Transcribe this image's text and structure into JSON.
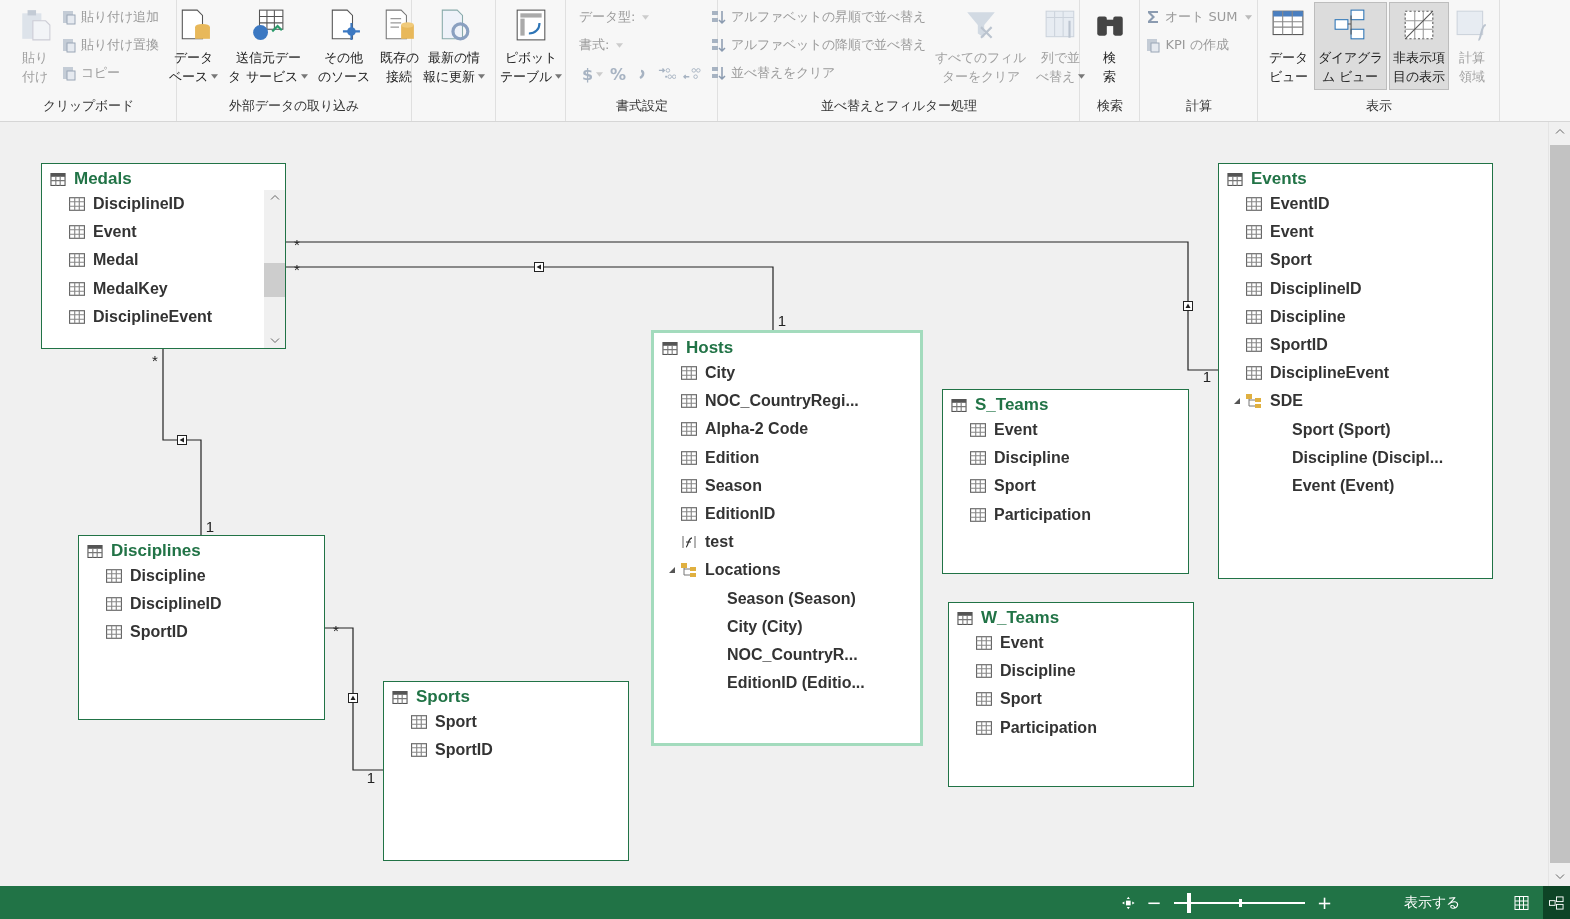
{
  "ribbon": {
    "groups": [
      {
        "label": "クリップボード",
        "items": [
          {
            "kind": "large",
            "lines": [
              "貼り",
              "付け"
            ],
            "disabled": true,
            "dropdown": false,
            "selected": false
          },
          {
            "kind": "stack",
            "items": [
              {
                "kind": "small",
                "label": "貼り付け追加",
                "disabled": true,
                "dropdown": false
              },
              {
                "kind": "small",
                "label": "貼り付け置換",
                "disabled": true,
                "dropdown": false
              },
              {
                "kind": "small",
                "label": "コピー",
                "disabled": true,
                "dropdown": false
              }
            ]
          }
        ]
      },
      {
        "label": "外部データの取り込み",
        "items": [
          {
            "kind": "large",
            "lines": [
              "データ",
              "ベース"
            ],
            "disabled": false,
            "dropdown": true,
            "selected": false
          },
          {
            "kind": "large",
            "lines": [
              "送信元デー",
              "タ サービス"
            ],
            "disabled": false,
            "dropdown": true,
            "selected": false
          },
          {
            "kind": "large",
            "lines": [
              "その他",
              "のソース"
            ],
            "disabled": false,
            "dropdown": false,
            "selected": false
          },
          {
            "kind": "large",
            "lines": [
              "既存の",
              "接続"
            ],
            "disabled": false,
            "dropdown": false,
            "selected": false
          }
        ]
      },
      {
        "items": [
          {
            "kind": "large",
            "lines": [
              "最新の情",
              "報に更新"
            ],
            "disabled": false,
            "dropdown": true,
            "selected": false
          }
        ]
      },
      {
        "items": [
          {
            "kind": "large",
            "lines": [
              "ピボット",
              "テーブル"
            ],
            "disabled": false,
            "dropdown": true,
            "selected": false
          }
        ]
      },
      {
        "label": "書式設定",
        "items": [
          {
            "kind": "stack",
            "items": [
              {
                "kind": "field-label",
                "label": "データ型:",
                "disabled": true,
                "dropdown": true
              },
              {
                "kind": "field-label",
                "label": "書式:",
                "disabled": true,
                "dropdown": true
              },
              {
                "kind": "symbol-row",
                "disabled": true,
                "symbols": [
                  {
                    "kind": "text",
                    "label": "$",
                    "dropdown": true
                  },
                  {
                    "kind": "text",
                    "label": "%",
                    "dropdown": false
                  },
                  {
                    "kind": "comma"
                  },
                  {
                    "kind": "inc-decimal"
                  },
                  {
                    "kind": "dec-decimal"
                  }
                ]
              }
            ]
          }
        ]
      },
      {
        "label": "並べ替えとフィルター処理",
        "items": [
          {
            "kind": "stack",
            "items": [
              {
                "kind": "small",
                "label": "アルファベットの昇順で並べ替え",
                "disabled": true,
                "dropdown": false
              },
              {
                "kind": "small",
                "label": "アルファベットの降順で並べ替え",
                "disabled": true,
                "dropdown": false
              },
              {
                "kind": "small",
                "label": "並べ替えをクリア",
                "disabled": true,
                "dropdown": false
              }
            ]
          },
          {
            "kind": "large",
            "lines": [
              "すべてのフィル",
              "ターをクリア"
            ],
            "disabled": true,
            "dropdown": false,
            "selected": false
          },
          {
            "kind": "large",
            "lines": [
              "列で並",
              "べ替え"
            ],
            "disabled": true,
            "dropdown": true,
            "selected": false
          }
        ]
      },
      {
        "label": "検索",
        "items": [
          {
            "kind": "large",
            "lines": [
              "検",
              "索"
            ],
            "disabled": false,
            "dropdown": false,
            "selected": false
          }
        ]
      },
      {
        "label": "計算",
        "items": [
          {
            "kind": "stack",
            "items": [
              {
                "kind": "small",
                "label": "オート SUM",
                "disabled": true,
                "dropdown": true
              },
              {
                "kind": "small",
                "label": "KPI の作成",
                "disabled": true,
                "dropdown": false
              }
            ]
          }
        ]
      },
      {
        "label": "表示",
        "items": [
          {
            "kind": "large",
            "lines": [
              "データ",
              "ビュー"
            ],
            "disabled": false,
            "dropdown": false,
            "selected": false
          },
          {
            "kind": "large",
            "lines": [
              "ダイアグラ",
              "ム ビュー"
            ],
            "disabled": false,
            "dropdown": false,
            "selected": true
          },
          {
            "kind": "large",
            "lines": [
              "非表示項",
              "目の表示"
            ],
            "disabled": false,
            "dropdown": false,
            "selected": true
          },
          {
            "kind": "large",
            "lines": [
              "計算",
              "領域"
            ],
            "disabled": true,
            "dropdown": false,
            "selected": false
          }
        ]
      }
    ]
  },
  "diagram": {
    "tables": [
      {
        "name": "Medals",
        "selected": false,
        "scrollable": true,
        "fields": [
          {
            "kind": "column",
            "name": "DisciplineID"
          },
          {
            "kind": "column",
            "name": "Event"
          },
          {
            "kind": "column",
            "name": "Medal"
          },
          {
            "kind": "column",
            "name": "MedalKey"
          },
          {
            "kind": "column",
            "name": "DisciplineEvent"
          }
        ]
      },
      {
        "name": "Events",
        "selected": false,
        "scrollable": false,
        "fields": [
          {
            "kind": "column",
            "name": "EventID"
          },
          {
            "kind": "column",
            "name": "Event"
          },
          {
            "kind": "column",
            "name": "Sport"
          },
          {
            "kind": "column",
            "name": "DisciplineID"
          },
          {
            "kind": "column",
            "name": "Discipline"
          },
          {
            "kind": "column",
            "name": "SportID"
          },
          {
            "kind": "column",
            "name": "DisciplineEvent"
          },
          {
            "kind": "hierarchy",
            "name": "SDE",
            "expanded": true,
            "children": [
              {
                "name": "Sport (Sport)"
              },
              {
                "name": "Discipline (Discipl..."
              },
              {
                "name": "Event (Event)"
              }
            ]
          }
        ]
      },
      {
        "name": "Hosts",
        "selected": true,
        "scrollable": false,
        "fields": [
          {
            "kind": "column",
            "name": "City"
          },
          {
            "kind": "column",
            "name": "NOC_CountryRegi..."
          },
          {
            "kind": "column",
            "name": "Alpha-2 Code"
          },
          {
            "kind": "column",
            "name": "Edition"
          },
          {
            "kind": "column",
            "name": "Season"
          },
          {
            "kind": "column",
            "name": "EditionID"
          },
          {
            "kind": "calculated",
            "name": "test"
          },
          {
            "kind": "hierarchy",
            "name": "Locations",
            "expanded": true,
            "children": [
              {
                "name": "Season (Season)"
              },
              {
                "name": "City (City)"
              },
              {
                "name": "NOC_CountryR..."
              },
              {
                "name": "EditionID (Editio..."
              }
            ]
          }
        ]
      },
      {
        "name": "S_Teams",
        "selected": false,
        "scrollable": false,
        "fields": [
          {
            "kind": "column",
            "name": "Event"
          },
          {
            "kind": "column",
            "name": "Discipline"
          },
          {
            "kind": "column",
            "name": "Sport"
          },
          {
            "kind": "column",
            "name": "Participation"
          }
        ]
      },
      {
        "name": "W_Teams",
        "selected": false,
        "scrollable": false,
        "fields": [
          {
            "kind": "column",
            "name": "Event"
          },
          {
            "kind": "column",
            "name": "Discipline"
          },
          {
            "kind": "column",
            "name": "Sport"
          },
          {
            "kind": "column",
            "name": "Participation"
          }
        ]
      },
      {
        "name": "Disciplines",
        "selected": false,
        "scrollable": false,
        "fields": [
          {
            "kind": "column",
            "name": "Discipline"
          },
          {
            "kind": "column",
            "name": "DisciplineID"
          },
          {
            "kind": "column",
            "name": "SportID"
          }
        ]
      },
      {
        "name": "Sports",
        "selected": false,
        "scrollable": false,
        "fields": [
          {
            "kind": "column",
            "name": "Sport"
          },
          {
            "kind": "column",
            "name": "SportID"
          }
        ]
      }
    ],
    "relationships": [
      {
        "many": "*",
        "one": "1"
      },
      {
        "many": "*",
        "one": "1"
      },
      {
        "many": "*",
        "one": "1"
      },
      {
        "many": "*",
        "one": "1"
      }
    ]
  },
  "status_bar": {
    "zoom": {
      "minus": "−",
      "plus": "+",
      "level": 0.12
    },
    "show_label": "表示する",
    "views": [
      {
        "kind": "grid",
        "selected": false
      },
      {
        "kind": "diagram",
        "selected": true
      }
    ]
  }
}
